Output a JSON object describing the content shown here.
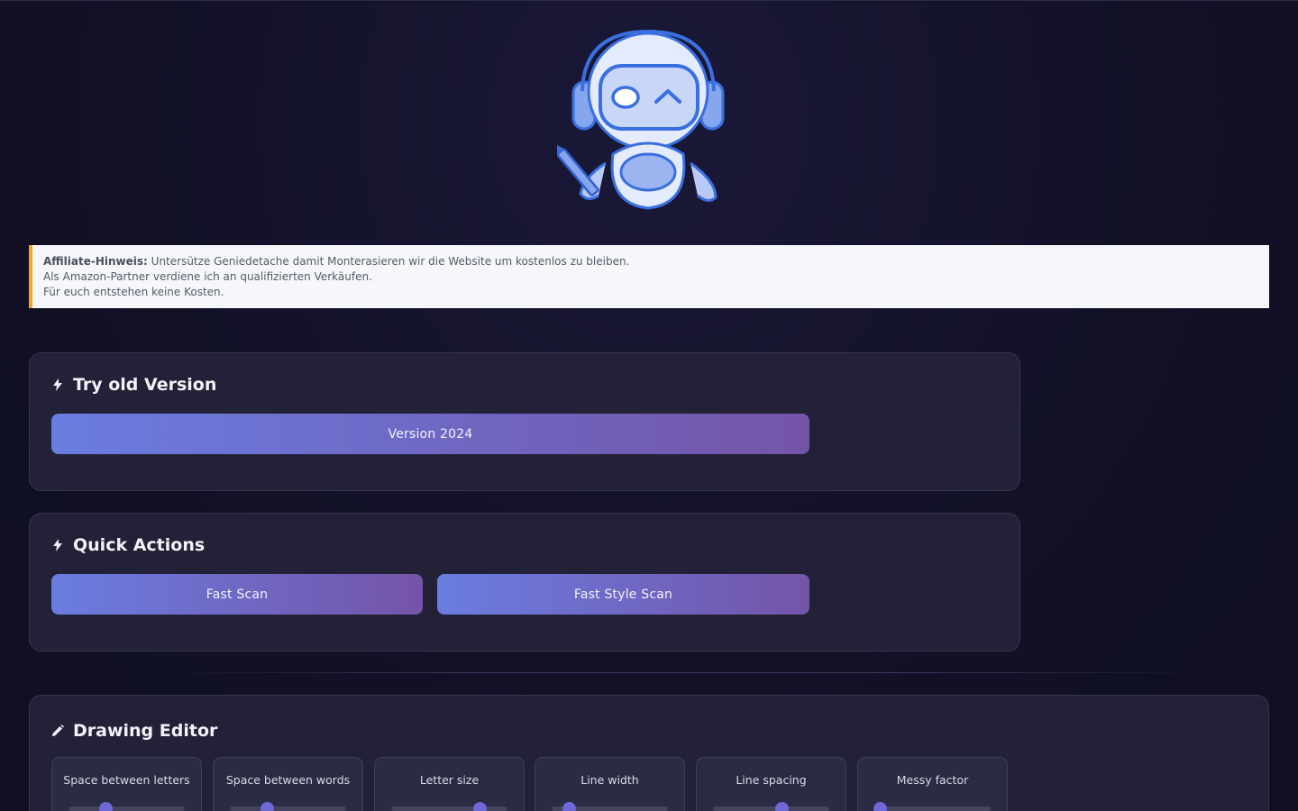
{
  "affiliate": {
    "label": "Affiliate-Hinweis:",
    "line1": "Untersütze Geniedetache damit Monterasieren wir die Website um kostenlos zu bleiben.",
    "line2": "Als Amazon-Partner verdiene ich an qualifizierten Verkäufen.",
    "line3": "Für euch entstehen keine Kosten."
  },
  "old_version": {
    "title": "Try old Version",
    "icon": "lightning-icon",
    "button_label": "Version 2024"
  },
  "quick_actions": {
    "title": "Quick Actions",
    "icon": "lightning-icon",
    "buttons": [
      {
        "label": "Fast Scan"
      },
      {
        "label": "Fast Style Scan"
      }
    ]
  },
  "drawing_editor": {
    "title": "Drawing Editor",
    "icon": "pencil-icon",
    "controls": [
      {
        "label": "Space between letters",
        "value": 0.32
      },
      {
        "label": "Space between words",
        "value": 0.32
      },
      {
        "label": "Letter size",
        "value": 0.76
      },
      {
        "label": "Line width",
        "value": 0.15
      },
      {
        "label": "Line spacing",
        "value": 0.59
      },
      {
        "label": "Messy factor",
        "value": 0.05
      }
    ]
  },
  "colors": {
    "accent_start": "#6a7de0",
    "accent_end": "#7454a8",
    "warning_border": "#f5a623",
    "slider_thumb": "#6f68d8"
  }
}
